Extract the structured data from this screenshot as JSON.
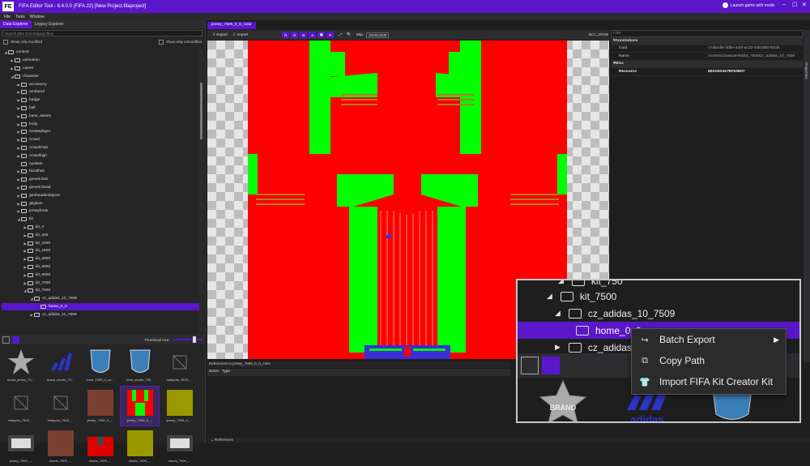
{
  "app": {
    "logo": "FE",
    "title": "FIFA Editor Tool - 6.4.0.0 (FIFA 22) [New Project.fifaproject]",
    "launch_label": "Launch game with mods",
    "minimize": "–",
    "maximize": "☐",
    "close": "✕"
  },
  "menu": [
    "File",
    "Tools",
    "Window"
  ],
  "left": {
    "tabs": [
      "Data Explorer",
      "Legacy Explorer"
    ],
    "search_placeholder": "Search EBX (non-legacy) files",
    "show_modified": "Show only modified",
    "show_unmodified": "Show only unmodified",
    "tree": [
      {
        "label": "content",
        "depth": 0,
        "open": true
      },
      {
        "label": "animation",
        "depth": 1
      },
      {
        "label": "career",
        "depth": 1
      },
      {
        "label": "character",
        "depth": 1,
        "open": true
      },
      {
        "label": "accessory",
        "depth": 2
      },
      {
        "label": "armband",
        "depth": 2
      },
      {
        "label": "badge",
        "depth": 2
      },
      {
        "label": "ball",
        "depth": 2
      },
      {
        "label": "base_assets",
        "depth": 2
      },
      {
        "label": "body",
        "depth": 2
      },
      {
        "label": "createplayer",
        "depth": 2
      },
      {
        "label": "crowd",
        "depth": 2
      },
      {
        "label": "crowdchair",
        "depth": 2
      },
      {
        "label": "crowdhigh",
        "depth": 2
      },
      {
        "label": "eyelash",
        "depth": 2,
        "leaf": true
      },
      {
        "label": "facialhair",
        "depth": 2
      },
      {
        "label": "genericheir",
        "depth": 2
      },
      {
        "label": "generichead",
        "depth": 2
      },
      {
        "label": "genheadtexlayers",
        "depth": 2
      },
      {
        "label": "gkglove",
        "depth": 2
      },
      {
        "label": "jerseyfonts",
        "depth": 2
      },
      {
        "label": "kit",
        "depth": 2,
        "open": true
      },
      {
        "label": "kit_0",
        "depth": 3
      },
      {
        "label": "kit_500",
        "depth": 3
      },
      {
        "label": "kit_1000",
        "depth": 3
      },
      {
        "label": "kit_1500",
        "depth": 3
      },
      {
        "label": "kit_2000",
        "depth": 3
      },
      {
        "label": "kit_5000",
        "depth": 3
      },
      {
        "label": "kit_6000",
        "depth": 3
      },
      {
        "label": "kit_7000",
        "depth": 3
      },
      {
        "label": "kit_7500",
        "depth": 3,
        "open": true
      },
      {
        "label": "cz_adidas_10_7509",
        "depth": 4,
        "open": true
      },
      {
        "label": "home_0_0",
        "depth": 5,
        "leaf": true,
        "selected": true
      },
      {
        "label": "cz_adidas_11_7509",
        "depth": 4
      }
    ],
    "thumbnail_size_label": "Thumbnail size:",
    "thumbnails": [
      {
        "label": "brand_jersey_75...",
        "kind": "star"
      },
      {
        "label": "brand_shorts_75...",
        "kind": "adidas"
      },
      {
        "label": "crest_7509_0_co...",
        "kind": "crest"
      },
      {
        "label": "crest_shorts_750...",
        "kind": "crest"
      },
      {
        "label": "hotspots_7509_...",
        "kind": "missing"
      },
      {
        "label": "hotspots_7509_...",
        "kind": "missing"
      },
      {
        "label": "hotspots_7509_...",
        "kind": "missing"
      },
      {
        "label": "jersey_7509_0_...",
        "kind": "brown"
      },
      {
        "label": "jersey_7509_0_...",
        "kind": "kit",
        "selected": true
      },
      {
        "label": "jersey_7509_0_...",
        "kind": "olive"
      },
      {
        "label": "jersey_7509_...",
        "kind": "dark"
      },
      {
        "label": "shorts_7509_...",
        "kind": "brown"
      },
      {
        "label": "shorts_7509_...",
        "kind": "red"
      },
      {
        "label": "shorts_7509_...",
        "kind": "olive"
      },
      {
        "label": "shorts_7509_...",
        "kind": "dark"
      }
    ]
  },
  "editor": {
    "tab": "jersey_7509_0_0_color",
    "export_label": "Export",
    "import_label": "Import",
    "channels": [
      "R",
      "G",
      "B",
      "A"
    ],
    "mips_label": "Mip:",
    "mip_value": "2048x2048",
    "format": "BC1_SRGB",
    "refs_header": "References to jersey_7509_0_0_color",
    "refs_cols": [
      "Name",
      "Type"
    ],
    "bottom_label": "References",
    "colors": {
      "red": "#ff0000",
      "green": "#00ff00",
      "navy": "#3a2fd8",
      "accent": "#5a17c9"
    }
  },
  "properties": {
    "filter_placeholder": "Filter",
    "side_tab": "Properties",
    "sections": [
      {
        "name": "Annotations",
        "rows": [
          {
            "k": "Guid",
            "v": "c7abadfe-3d5e-440f-ac22-435168078345"
          },
          {
            "k": "Name",
            "v": "content/character/kit/kit_7500/cz_adidas_10_7509"
          }
        ]
      },
      {
        "name": "Misc",
        "rows": [
          {
            "k": "Resource",
            "v": "6E01ED3276F538D7",
            "bold": true
          }
        ]
      }
    ]
  },
  "zoom": {
    "rows": [
      {
        "label": "kit_750",
        "indent": 1
      },
      {
        "label": "kit_7500",
        "indent": 2
      },
      {
        "label": "cz_adidas_10_7509",
        "indent": 3
      },
      {
        "label": "home_0_0",
        "indent": 4,
        "selected": true
      },
      {
        "label": "cz_adidas_11_7509",
        "indent": 3
      }
    ],
    "brand_text": "BRAND",
    "adidas_text": "adidas"
  },
  "context_menu": {
    "items": [
      {
        "label": "Batch Export",
        "icon": "↪",
        "submenu": "▶"
      },
      {
        "label": "Copy Path",
        "icon": "⧉"
      },
      {
        "label": "Import FIFA Kit Creator Kit",
        "icon": "👕"
      }
    ]
  }
}
